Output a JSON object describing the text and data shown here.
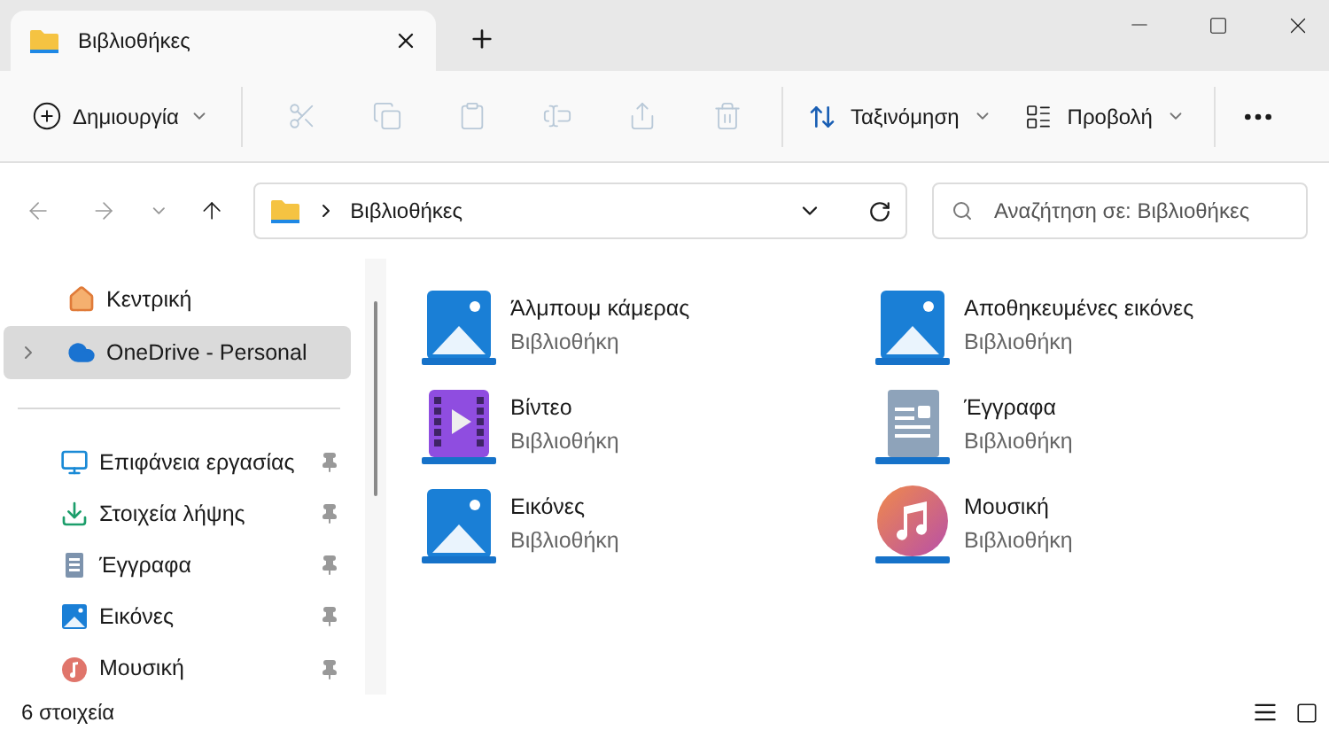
{
  "tabs": [
    {
      "label": "Βιβλιοθήκες",
      "selected": true
    }
  ],
  "toolbar": {
    "new_label": "Δημιουργία",
    "actions": [
      {
        "kind": "cut",
        "disabled": true
      },
      {
        "kind": "copy",
        "disabled": true
      },
      {
        "kind": "paste",
        "disabled": true
      },
      {
        "kind": "rename",
        "disabled": true
      },
      {
        "kind": "share",
        "disabled": true
      },
      {
        "kind": "delete",
        "disabled": true
      }
    ],
    "sort_label": "Ταξινόμηση",
    "view_label": "Προβολή"
  },
  "address": {
    "path": "Βιβλιοθήκες"
  },
  "search": {
    "placeholder": "Αναζήτηση σε: Βιβλιοθήκες"
  },
  "sidebar": {
    "top": [
      {
        "label": "Κεντρική",
        "kind": "home",
        "selected": false,
        "expandable": false
      },
      {
        "label": "OneDrive - Personal",
        "kind": "cloud",
        "selected": true,
        "expandable": true
      }
    ],
    "quick_access": [
      {
        "label": "Επιφάνεια εργασίας",
        "kind": "desktop",
        "pinned": true
      },
      {
        "label": "Στοιχεία λήψης",
        "kind": "download",
        "pinned": true
      },
      {
        "label": "Έγγραφα",
        "kind": "document",
        "pinned": true
      },
      {
        "label": "Εικόνες",
        "kind": "picture",
        "pinned": true
      },
      {
        "label": "Μουσική",
        "kind": "music",
        "pinned": true
      }
    ]
  },
  "libraries": [
    {
      "name": "Άλμπουμ κάμερας",
      "type": "Βιβλιοθήκη",
      "kind": "picture"
    },
    {
      "name": "Αποθηκευμένες εικόνες",
      "type": "Βιβλιοθήκη",
      "kind": "picture"
    },
    {
      "name": "Βίντεο",
      "type": "Βιβλιοθήκη",
      "kind": "video"
    },
    {
      "name": "Έγγραφα",
      "type": "Βιβλιοθήκη",
      "kind": "document"
    },
    {
      "name": "Εικόνες",
      "type": "Βιβλιοθήκη",
      "kind": "picture"
    },
    {
      "name": "Μουσική",
      "type": "Βιβλιοθήκη",
      "kind": "music"
    }
  ],
  "status_bar": {
    "count": "6 στοιχεία"
  }
}
